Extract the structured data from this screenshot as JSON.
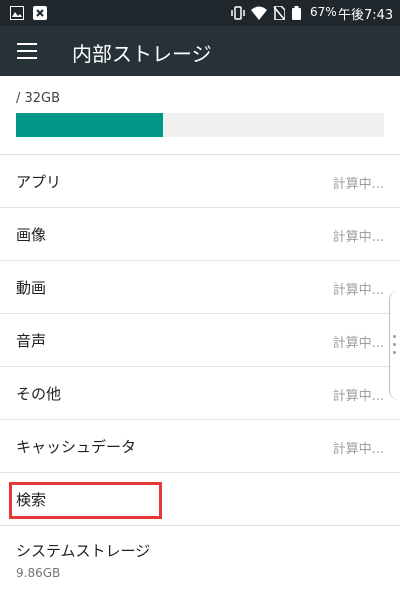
{
  "status_bar": {
    "battery": "67%",
    "time": "午後7:43",
    "icons": [
      "image-icon",
      "close-notification-icon",
      "vibrate-icon",
      "wifi-icon",
      "no-sim-icon",
      "battery-icon"
    ]
  },
  "toolbar": {
    "title": "内部ストレージ",
    "menu_icon": "hamburger-menu-icon"
  },
  "storage": {
    "total_label": "/ 32GB",
    "used_fraction": 0.4,
    "bar_color": "#009688"
  },
  "categories": [
    {
      "label": "アプリ",
      "value": "計算中..."
    },
    {
      "label": "画像",
      "value": "計算中..."
    },
    {
      "label": "動画",
      "value": "計算中..."
    },
    {
      "label": "音声",
      "value": "計算中..."
    },
    {
      "label": "その他",
      "value": "計算中..."
    },
    {
      "label": "キャッシュデータ",
      "value": "計算中..."
    },
    {
      "label": "検索",
      "value": ""
    },
    {
      "label": "システムストレージ",
      "value": "9.86GB"
    }
  ],
  "colors": {
    "toolbar": "#263238",
    "status_bar": "#1f272c",
    "accent": "#009688",
    "highlight": "#e53935"
  }
}
